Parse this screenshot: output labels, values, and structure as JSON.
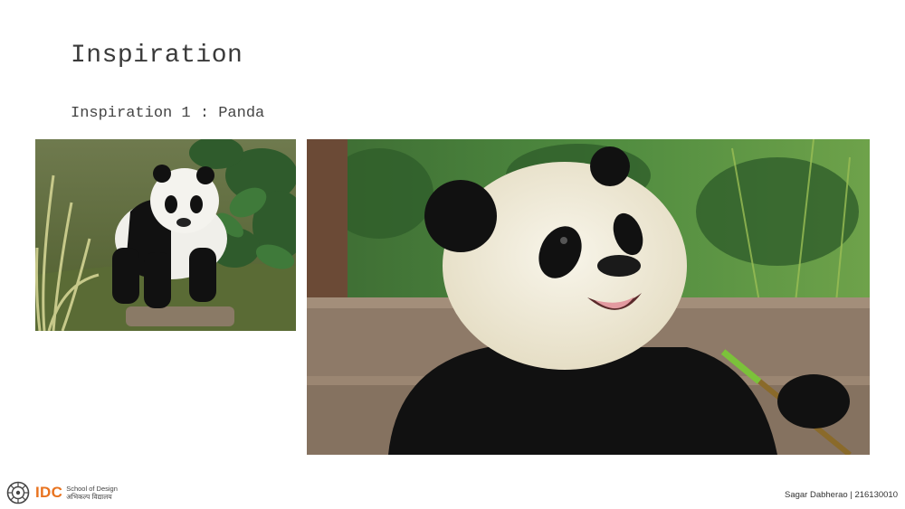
{
  "slide": {
    "title": "Inspiration",
    "subtitle": "Inspiration 1 : Panda"
  },
  "images": [
    {
      "name": "panda-standing-photo",
      "description_icon": "panda-standing"
    },
    {
      "name": "panda-eating-bamboo-photo",
      "description_icon": "panda-closeup"
    }
  ],
  "footer": {
    "logo": {
      "acronym": "IDC",
      "line1": "School of Design",
      "line2": "अभिकल्प विद्यालय"
    },
    "author": "Sagar Dabherao | 216130010"
  },
  "colors": {
    "logo_orange": "#e8731f",
    "text": "#333333",
    "background": "#ffffff"
  }
}
